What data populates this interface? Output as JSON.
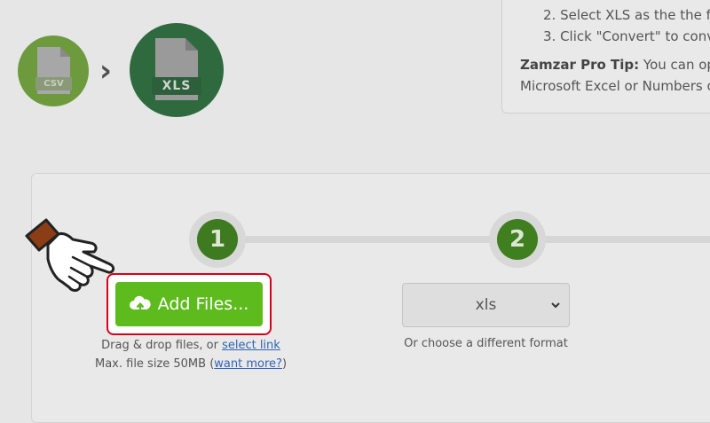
{
  "conversion": {
    "source_format": "CSV",
    "target_format": "XLS",
    "arrow": "›"
  },
  "instructions": {
    "steps": [
      "2. Select XLS as the the fo",
      "3. Click \"Convert\" to conv"
    ],
    "tip_label": "Zamzar Pro Tip:",
    "tip_line1": " You can ope",
    "tip_line2": "Microsoft Excel or Numbers o"
  },
  "steps": {
    "step1": "1",
    "step2": "2"
  },
  "upload": {
    "add_files_label": "Add Files...",
    "drag_prefix": "Drag & drop files, or ",
    "select_link": "select link",
    "max_prefix": "Max. file size 50MB (",
    "want_more_link": "want more?",
    "max_suffix": ")"
  },
  "format": {
    "selected": "xls",
    "hint": "Or choose a different format"
  },
  "colors": {
    "button_green": "#5dbb1e",
    "step_green": "#3e7a1f",
    "highlight_red": "#d9001b",
    "link_blue": "#2f63b5"
  }
}
